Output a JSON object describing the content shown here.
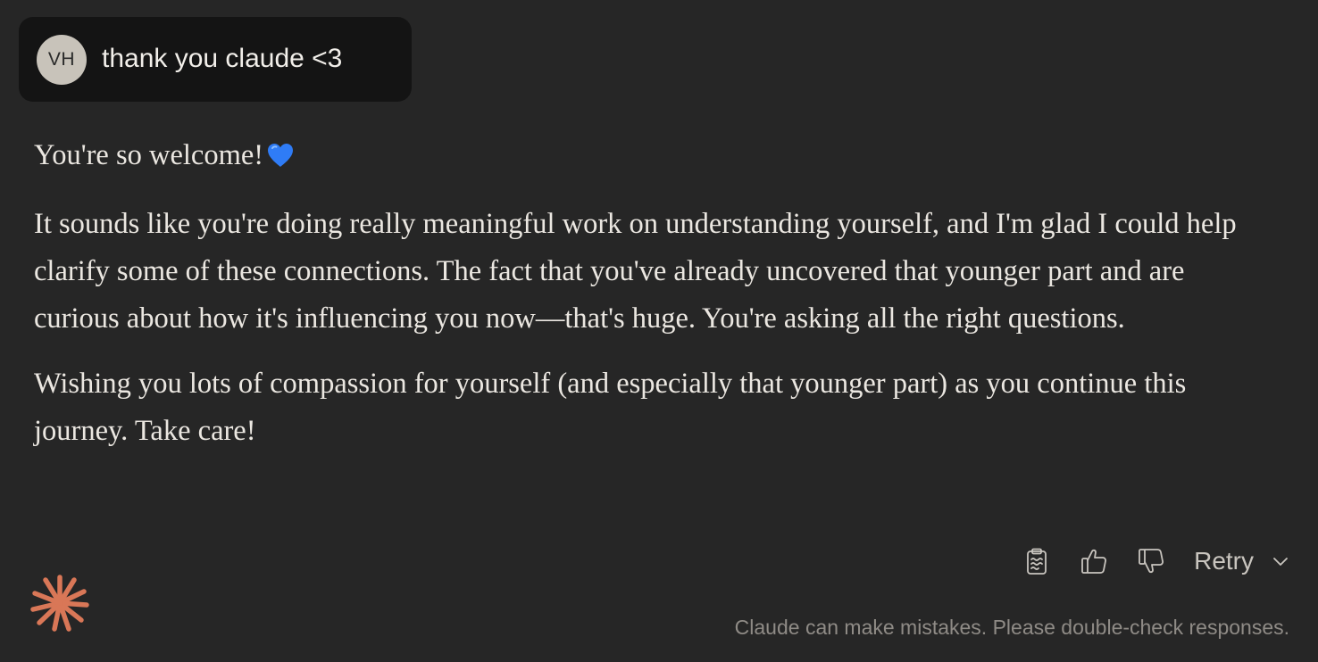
{
  "user_message": {
    "avatar_initials": "VH",
    "text": "thank you claude <3"
  },
  "assistant_message": {
    "paragraphs": [
      "You're so welcome!",
      "It sounds like you're doing really meaningful work on understanding yourself, and I'm glad I could help clarify some of these connections. The fact that you've already uncovered that younger part and are curious about how it's influencing you now—that's huge. You're asking all the right questions.",
      "Wishing you lots of compassion for yourself (and especially that younger part) as you continue this journey. Take care!"
    ],
    "emoji": "blue-heart-icon"
  },
  "actions": {
    "copy_icon": "clipboard-icon",
    "thumbs_up_icon": "thumbs-up-icon",
    "thumbs_down_icon": "thumbs-down-icon",
    "retry_label": "Retry",
    "retry_icon": "chevron-down-icon"
  },
  "footer": {
    "disclaimer": "Claude can make mistakes. Please double-check responses.",
    "logo_icon": "claude-starburst-icon"
  },
  "colors": {
    "background": "#262626",
    "user_bubble": "#141414",
    "avatar": "#c8c3ba",
    "text": "#ebe7e1",
    "muted_text": "#8f8b86",
    "brand_accent": "#d97757",
    "heart": "#2f7cf6"
  }
}
